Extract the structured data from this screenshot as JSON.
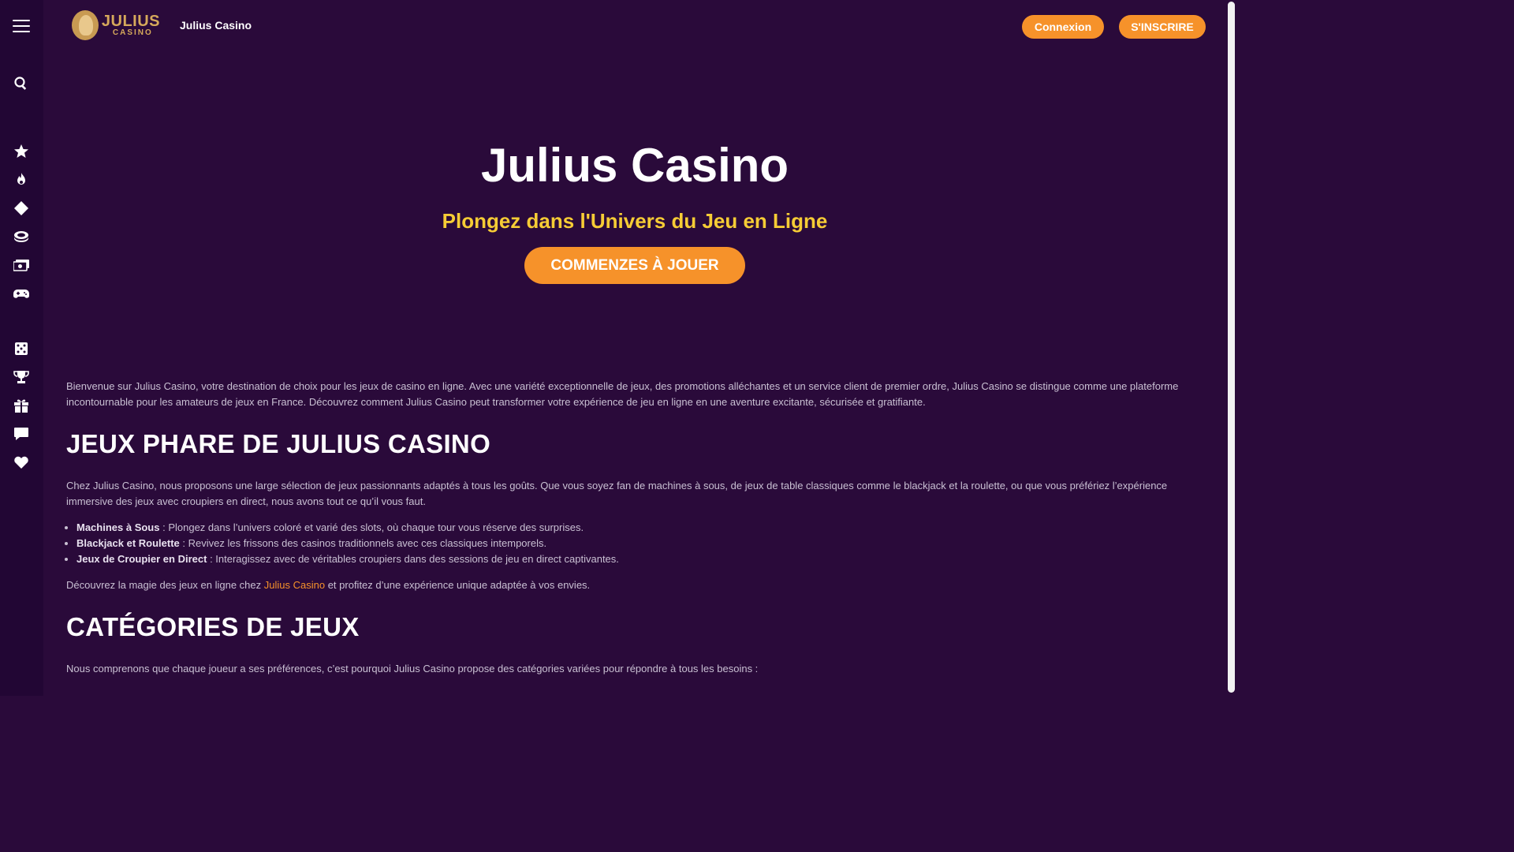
{
  "header": {
    "logo": {
      "line1": "JULIUS",
      "line2": "CASINO"
    },
    "site_name": "Julius Casino",
    "login_label": "Connexion",
    "signup_label": "S'INSCRIRE"
  },
  "sidebar": {
    "icons": [
      "menu-icon",
      "search-icon",
      "star-icon",
      "fire-icon",
      "diamond-icon",
      "chip-icon",
      "money-icon",
      "gamepad-icon",
      "dice-icon",
      "trophy-icon",
      "gift-icon",
      "chat-icon",
      "heart-icon"
    ]
  },
  "hero": {
    "title": "Julius Casino",
    "subtitle": "Plongez dans l'Univers du Jeu en Ligne",
    "cta": "COMMENZES À JOUER"
  },
  "content": {
    "intro": "Bienvenue sur Julius Casino, votre destination de choix pour les jeux de casino en ligne. Avec une variété exceptionnelle de jeux, des promotions alléchantes et un service client de premier ordre, Julius Casino se distingue comme une plateforme incontournable pour les amateurs de jeux en France. Découvrez comment Julius Casino peut transformer votre expérience de jeu en ligne en une aventure excitante, sécurisée et gratifiante.",
    "section1_title": "JEUX PHARE DE JULIUS CASINO",
    "section1_text": "Chez Julius Casino, nous proposons une large sélection de jeux passionnants adaptés à tous les goûts. Que vous soyez fan de machines à sous, de jeux de table classiques comme le blackjack et la roulette, ou que vous préfériez l’expérience immersive des jeux avec croupiers en direct, nous avons tout ce qu’il vous faut.",
    "list": [
      {
        "bold": "Machines à Sous",
        "text": " : Plongez dans l’univers coloré et varié des slots, où chaque tour vous réserve des surprises."
      },
      {
        "bold": "Blackjack et Roulette",
        "text": " : Revivez les frissons des casinos traditionnels avec ces classiques intemporels."
      },
      {
        "bold": "Jeux de Croupier en Direct",
        "text": " : Interagissez avec de véritables croupiers dans des sessions de jeu en direct captivantes."
      }
    ],
    "closing_before": "Découvrez la magie des jeux en ligne chez ",
    "closing_link": "Julius Casino",
    "closing_after": " et profitez d’une expérience unique adaptée à vos envies.",
    "section2_title": "CATÉGORIES DE JEUX",
    "section2_text": "Nous comprenons que chaque joueur a ses préférences, c’est pourquoi Julius Casino propose des catégories variées pour répondre à tous les besoins :"
  },
  "colors": {
    "background": "#2a0a3a",
    "sidebar": "#220634",
    "accent": "#f6922a",
    "subtitle": "#f6cc35"
  }
}
